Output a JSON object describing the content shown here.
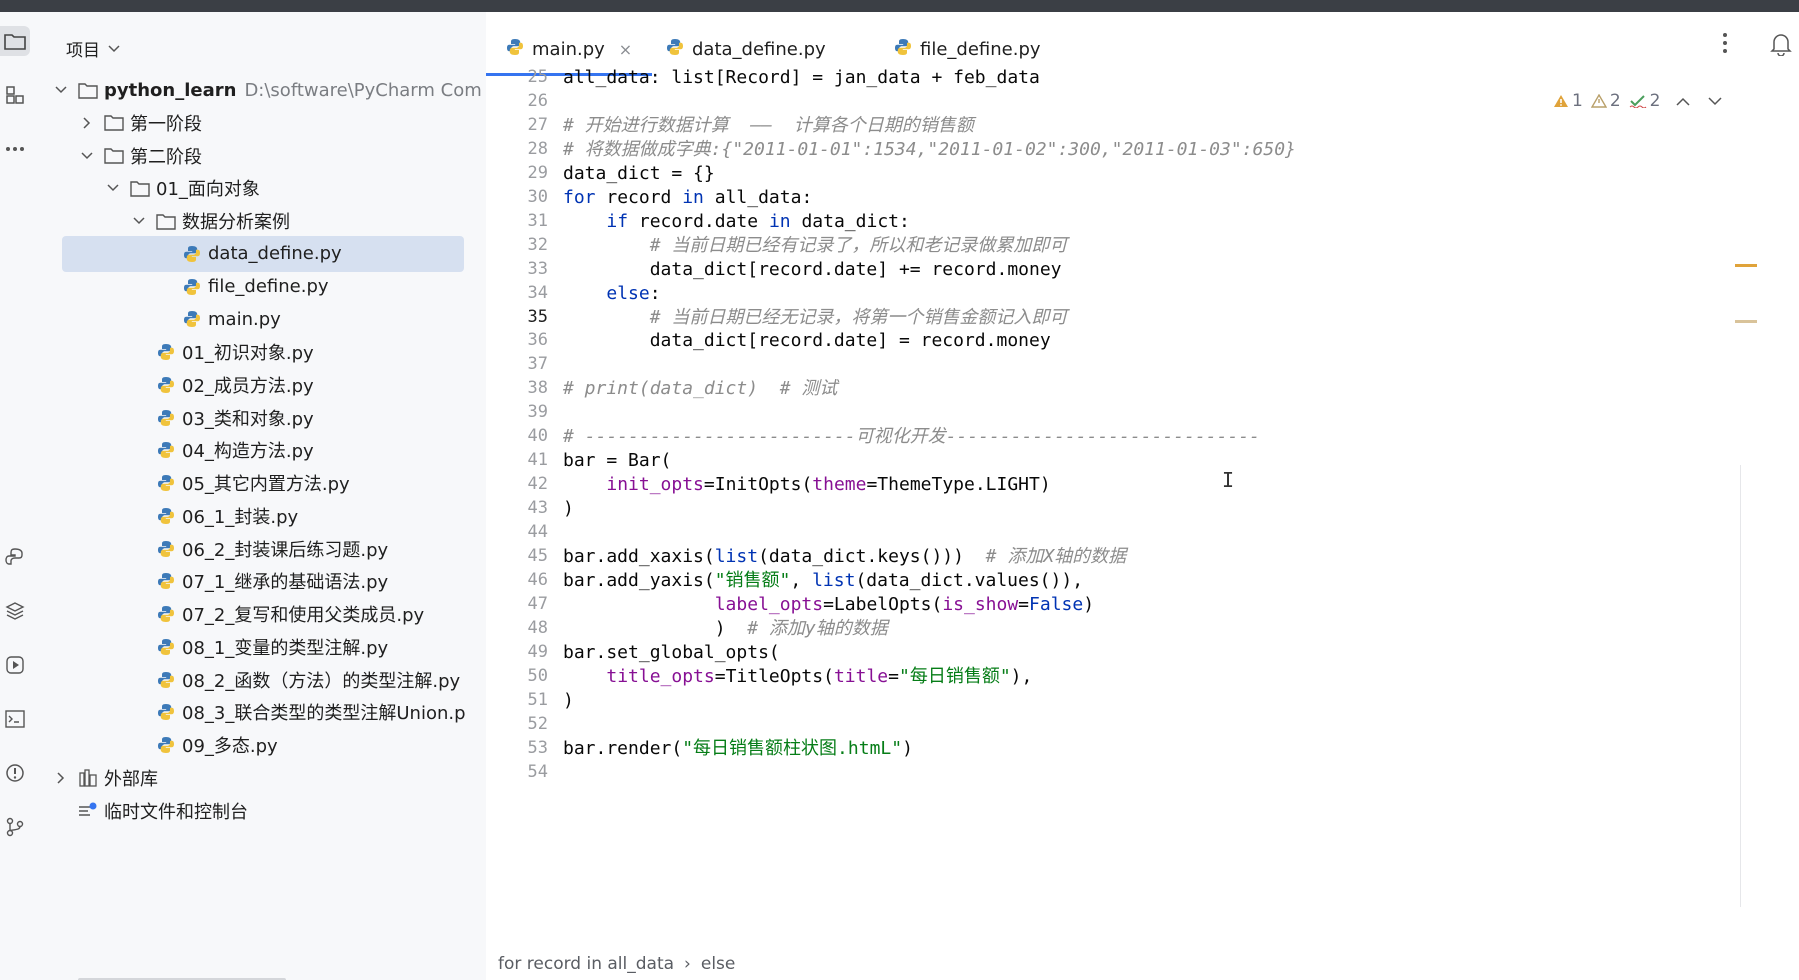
{
  "project_panel": {
    "title": "项目",
    "tree": [
      {
        "label": "python_learn",
        "hint": "D:\\software\\PyCharm Com",
        "type": "folder",
        "depth": 0,
        "expanded": true
      },
      {
        "label": "第一阶段",
        "type": "folder",
        "depth": 1,
        "expanded": false
      },
      {
        "label": "第二阶段",
        "type": "folder",
        "depth": 1,
        "expanded": true
      },
      {
        "label": "01_面向对象",
        "type": "folder",
        "depth": 2,
        "expanded": true
      },
      {
        "label": "数据分析案例",
        "type": "folder",
        "depth": 3,
        "expanded": true
      },
      {
        "label": "data_define.py",
        "type": "py",
        "depth": 4,
        "selected": true
      },
      {
        "label": "file_define.py",
        "type": "py",
        "depth": 4
      },
      {
        "label": "main.py",
        "type": "py",
        "depth": 4
      },
      {
        "label": "01_初识对象.py",
        "type": "py",
        "depth": 3
      },
      {
        "label": "02_成员方法.py",
        "type": "py",
        "depth": 3
      },
      {
        "label": "03_类和对象.py",
        "type": "py",
        "depth": 3
      },
      {
        "label": "04_构造方法.py",
        "type": "py",
        "depth": 3
      },
      {
        "label": "05_其它内置方法.py",
        "type": "py",
        "depth": 3
      },
      {
        "label": "06_1_封装.py",
        "type": "py",
        "depth": 3
      },
      {
        "label": "06_2_封装课后练习题.py",
        "type": "py",
        "depth": 3
      },
      {
        "label": "07_1_继承的基础语法.py",
        "type": "py",
        "depth": 3
      },
      {
        "label": "07_2_复写和使用父类成员.py",
        "type": "py",
        "depth": 3
      },
      {
        "label": "08_1_变量的类型注解.py",
        "type": "py",
        "depth": 3
      },
      {
        "label": "08_2_函数（方法）的类型注解.py",
        "type": "py",
        "depth": 3
      },
      {
        "label": "08_3_联合类型的类型注解Union.p",
        "type": "py",
        "depth": 3
      },
      {
        "label": "09_多态.py",
        "type": "py",
        "depth": 3
      },
      {
        "label": "外部库",
        "type": "lib",
        "depth": 0,
        "expanded": false
      },
      {
        "label": "临时文件和控制台",
        "type": "scratch",
        "depth": 0
      }
    ]
  },
  "tabs": [
    {
      "label": "main.py",
      "active": true,
      "close": "×"
    },
    {
      "label": "data_define.py",
      "active": false
    },
    {
      "label": "file_define.py",
      "active": false
    }
  ],
  "inspections": {
    "warn1": "1",
    "warn2": "2",
    "ok": "2"
  },
  "editor": {
    "current_line": "35",
    "lines": [
      {
        "n": "25",
        "html": "all_data: list[Record] = jan_data + feb_data"
      },
      {
        "n": "26",
        "html": ""
      },
      {
        "n": "27",
        "html": "<span class='cm'># 开始进行数据计算  ——  计算各个日期的销售额</span>"
      },
      {
        "n": "28",
        "html": "<span class='cm'># 将数据做成字典:{\"2011-01-01\":1534,\"2011-01-02\":300,\"2011-01-03\":650}</span>"
      },
      {
        "n": "29",
        "html": "data_dict = {}"
      },
      {
        "n": "30",
        "html": "<span class='kw'>for</span> record <span class='kw'>in</span> all_data:"
      },
      {
        "n": "31",
        "html": "    <span class='kw'>if</span> record.date <span class='kw'>in</span> data_dict:"
      },
      {
        "n": "32",
        "html": "        <span class='cm'># 当前日期已经有记录了，所以和老记录做累加即可</span>"
      },
      {
        "n": "33",
        "html": "        data_dict[record.date] += record.money"
      },
      {
        "n": "34",
        "html": "    <span class='kw'>else</span>:"
      },
      {
        "n": "35",
        "html": "        <span class='cm'># 当前日期已经无记录，将第一个销售金额记入即可</span>"
      },
      {
        "n": "36",
        "html": "        data_dict[record.date] = record.money"
      },
      {
        "n": "37",
        "html": ""
      },
      {
        "n": "38",
        "html": "<span class='cm'># print(data_dict)  # 测试</span>"
      },
      {
        "n": "39",
        "html": ""
      },
      {
        "n": "40",
        "html": "<span class='cm'># -------------------------可视化开发-----------------------------</span>"
      },
      {
        "n": "41",
        "html": "bar = Bar("
      },
      {
        "n": "42",
        "html": "    <span class='param'>init_opts</span>=InitOpts(<span class='param'>theme</span>=ThemeType.LIGHT)"
      },
      {
        "n": "43",
        "html": ")"
      },
      {
        "n": "44",
        "html": ""
      },
      {
        "n": "45",
        "html": "bar.add_xaxis(<span class='kw'>list</span>(data_dict.keys()))  <span class='cm'># 添加X轴的数据</span>"
      },
      {
        "n": "46",
        "html": "bar.add_yaxis(<span class='str'>\"销售额\"</span>, <span class='kw'>list</span>(data_dict.values()),"
      },
      {
        "n": "47",
        "html": "              <span class='param'>label_opts</span>=LabelOpts(<span class='param'>is_show</span>=<span class='bool'>False</span>)"
      },
      {
        "n": "48",
        "html": "              )  <span class='cm'># 添加y轴的数据</span>"
      },
      {
        "n": "49",
        "html": "bar.set_global_opts("
      },
      {
        "n": "50",
        "html": "    <span class='param'>title_opts</span>=TitleOpts(<span class='param'>title</span>=<span class='str'>\"每日销售额\"</span>),"
      },
      {
        "n": "51",
        "html": ")"
      },
      {
        "n": "52",
        "html": ""
      },
      {
        "n": "53",
        "html": "bar.render(<span class='str'>\"每日销售额柱状图.htmL\"</span>)"
      },
      {
        "n": "54",
        "html": ""
      }
    ]
  },
  "breadcrumb": [
    "for record in all_data",
    "else"
  ],
  "breadcrumb_sep": "›",
  "colors": {
    "accent": "#3574f0",
    "selection": "#d6e0f0",
    "warning": "#e0a33a",
    "ok": "#4a9e5c"
  }
}
